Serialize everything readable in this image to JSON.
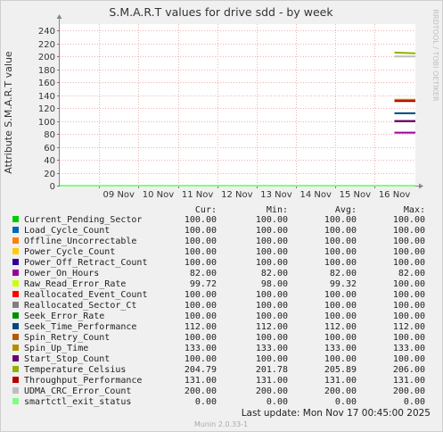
{
  "title": "S.M.A.R.T values for drive sdd - by week",
  "side_label": "RRDTOOL / TOBI OETIKER",
  "chart_data": {
    "type": "line",
    "title": "S.M.A.R.T values for drive sdd - by week",
    "ylabel": "Attribute S.M.A.R.T value",
    "xlabel": "",
    "ylim": [
      0,
      250
    ],
    "yticks": [
      0,
      20,
      40,
      60,
      80,
      100,
      120,
      140,
      160,
      180,
      200,
      220,
      240
    ],
    "xlim": [
      "2025-11-08 00:00",
      "2025-11-17 00:45"
    ],
    "xticks": [
      {
        "label": "09 Nov",
        "at": "2025-11-09 00:00"
      },
      {
        "label": "10 Nov",
        "at": "2025-11-10 00:00"
      },
      {
        "label": "11 Nov",
        "at": "2025-11-11 00:00"
      },
      {
        "label": "12 Nov",
        "at": "2025-11-12 00:00"
      },
      {
        "label": "13 Nov",
        "at": "2025-11-13 00:00"
      },
      {
        "label": "14 Nov",
        "at": "2025-11-14 00:00"
      },
      {
        "label": "15 Nov",
        "at": "2025-11-15 00:00"
      },
      {
        "label": "16 Nov",
        "at": "2025-11-16 00:00"
      }
    ],
    "grid": true,
    "legend": "bottom",
    "columns": [
      "Cur:",
      "Min:",
      "Avg:",
      "Max:"
    ],
    "series": [
      {
        "name": "Current_Pending_Sector",
        "color": "#00cc00",
        "cur": "100.00",
        "min": "100.00",
        "avg": "100.00",
        "max": "100.00",
        "points": [
          [
            "2025-11-16 12:00",
            100
          ],
          [
            "2025-11-17 00:45",
            100
          ]
        ]
      },
      {
        "name": "Load_Cycle_Count",
        "color": "#0066b3",
        "cur": "100.00",
        "min": "100.00",
        "avg": "100.00",
        "max": "100.00",
        "points": [
          [
            "2025-11-16 12:00",
            100
          ],
          [
            "2025-11-17 00:45",
            100
          ]
        ]
      },
      {
        "name": "Offline_Uncorrectable",
        "color": "#ff8000",
        "cur": "100.00",
        "min": "100.00",
        "avg": "100.00",
        "max": "100.00",
        "points": [
          [
            "2025-11-16 12:00",
            100
          ],
          [
            "2025-11-17 00:45",
            100
          ]
        ]
      },
      {
        "name": "Power_Cycle_Count",
        "color": "#ffcc00",
        "cur": "100.00",
        "min": "100.00",
        "avg": "100.00",
        "max": "100.00",
        "points": [
          [
            "2025-11-16 12:00",
            100
          ],
          [
            "2025-11-17 00:45",
            100
          ]
        ]
      },
      {
        "name": "Power_Off_Retract_Count",
        "color": "#330099",
        "cur": "100.00",
        "min": "100.00",
        "avg": "100.00",
        "max": "100.00",
        "points": [
          [
            "2025-11-16 12:00",
            100
          ],
          [
            "2025-11-17 00:45",
            100
          ]
        ]
      },
      {
        "name": "Power_On_Hours",
        "color": "#990099",
        "cur": "82.00",
        "min": "82.00",
        "avg": "82.00",
        "max": "82.00",
        "points": [
          [
            "2025-11-16 12:00",
            82
          ],
          [
            "2025-11-17 00:45",
            82
          ]
        ]
      },
      {
        "name": "Raw_Read_Error_Rate",
        "color": "#ccff00",
        "cur": "99.72",
        "min": "98.00",
        "avg": "99.32",
        "max": "100.00",
        "points": [
          [
            "2025-11-16 12:00",
            99.7
          ],
          [
            "2025-11-17 00:45",
            99.72
          ]
        ]
      },
      {
        "name": "Reallocated_Event_Count",
        "color": "#ff0000",
        "cur": "100.00",
        "min": "100.00",
        "avg": "100.00",
        "max": "100.00",
        "points": [
          [
            "2025-11-16 12:00",
            100
          ],
          [
            "2025-11-17 00:45",
            100
          ]
        ]
      },
      {
        "name": "Reallocated_Sector_Ct",
        "color": "#808080",
        "cur": "100.00",
        "min": "100.00",
        "avg": "100.00",
        "max": "100.00",
        "points": [
          [
            "2025-11-16 12:00",
            100
          ],
          [
            "2025-11-17 00:45",
            100
          ]
        ]
      },
      {
        "name": "Seek_Error_Rate",
        "color": "#008f00",
        "cur": "100.00",
        "min": "100.00",
        "avg": "100.00",
        "max": "100.00",
        "points": [
          [
            "2025-11-16 12:00",
            100
          ],
          [
            "2025-11-17 00:45",
            100
          ]
        ]
      },
      {
        "name": "Seek_Time_Performance",
        "color": "#00487d",
        "cur": "112.00",
        "min": "112.00",
        "avg": "112.00",
        "max": "112.00",
        "points": [
          [
            "2025-11-16 12:00",
            112
          ],
          [
            "2025-11-17 00:45",
            112
          ]
        ]
      },
      {
        "name": "Spin_Retry_Count",
        "color": "#b35a00",
        "cur": "100.00",
        "min": "100.00",
        "avg": "100.00",
        "max": "100.00",
        "points": [
          [
            "2025-11-16 12:00",
            100
          ],
          [
            "2025-11-17 00:45",
            100
          ]
        ]
      },
      {
        "name": "Spin_Up_Time",
        "color": "#b38f00",
        "cur": "133.00",
        "min": "133.00",
        "avg": "133.00",
        "max": "133.00",
        "points": [
          [
            "2025-11-16 12:00",
            133
          ],
          [
            "2025-11-17 00:45",
            133
          ]
        ]
      },
      {
        "name": "Start_Stop_Count",
        "color": "#6b006b",
        "cur": "100.00",
        "min": "100.00",
        "avg": "100.00",
        "max": "100.00",
        "points": [
          [
            "2025-11-16 12:00",
            100
          ],
          [
            "2025-11-17 00:45",
            100
          ]
        ]
      },
      {
        "name": "Temperature_Celsius",
        "color": "#8fb300",
        "cur": "204.79",
        "min": "201.78",
        "avg": "205.89",
        "max": "206.00",
        "points": [
          [
            "2025-11-16 12:00",
            206
          ],
          [
            "2025-11-17 00:45",
            204.79
          ]
        ]
      },
      {
        "name": "Throughput_Performance",
        "color": "#b30000",
        "cur": "131.00",
        "min": "131.00",
        "avg": "131.00",
        "max": "131.00",
        "points": [
          [
            "2025-11-16 12:00",
            131
          ],
          [
            "2025-11-17 00:45",
            131
          ]
        ]
      },
      {
        "name": "UDMA_CRC_Error_Count",
        "color": "#bebebe",
        "cur": "200.00",
        "min": "200.00",
        "avg": "200.00",
        "max": "200.00",
        "points": [
          [
            "2025-11-16 12:00",
            200
          ],
          [
            "2025-11-17 00:45",
            200
          ]
        ]
      },
      {
        "name": "smartctl_exit_status",
        "color": "#80ff80",
        "cur": "0.00",
        "min": "0.00",
        "avg": "0.00",
        "max": "0.00",
        "points": [
          [
            "2025-11-08 00:00",
            0
          ],
          [
            "2025-11-17 00:45",
            0
          ]
        ]
      }
    ]
  },
  "footer": {
    "last_update": "Last update:  Mon Nov 17 00:45:00 2025",
    "version": "Munin 2.0.33-1"
  }
}
